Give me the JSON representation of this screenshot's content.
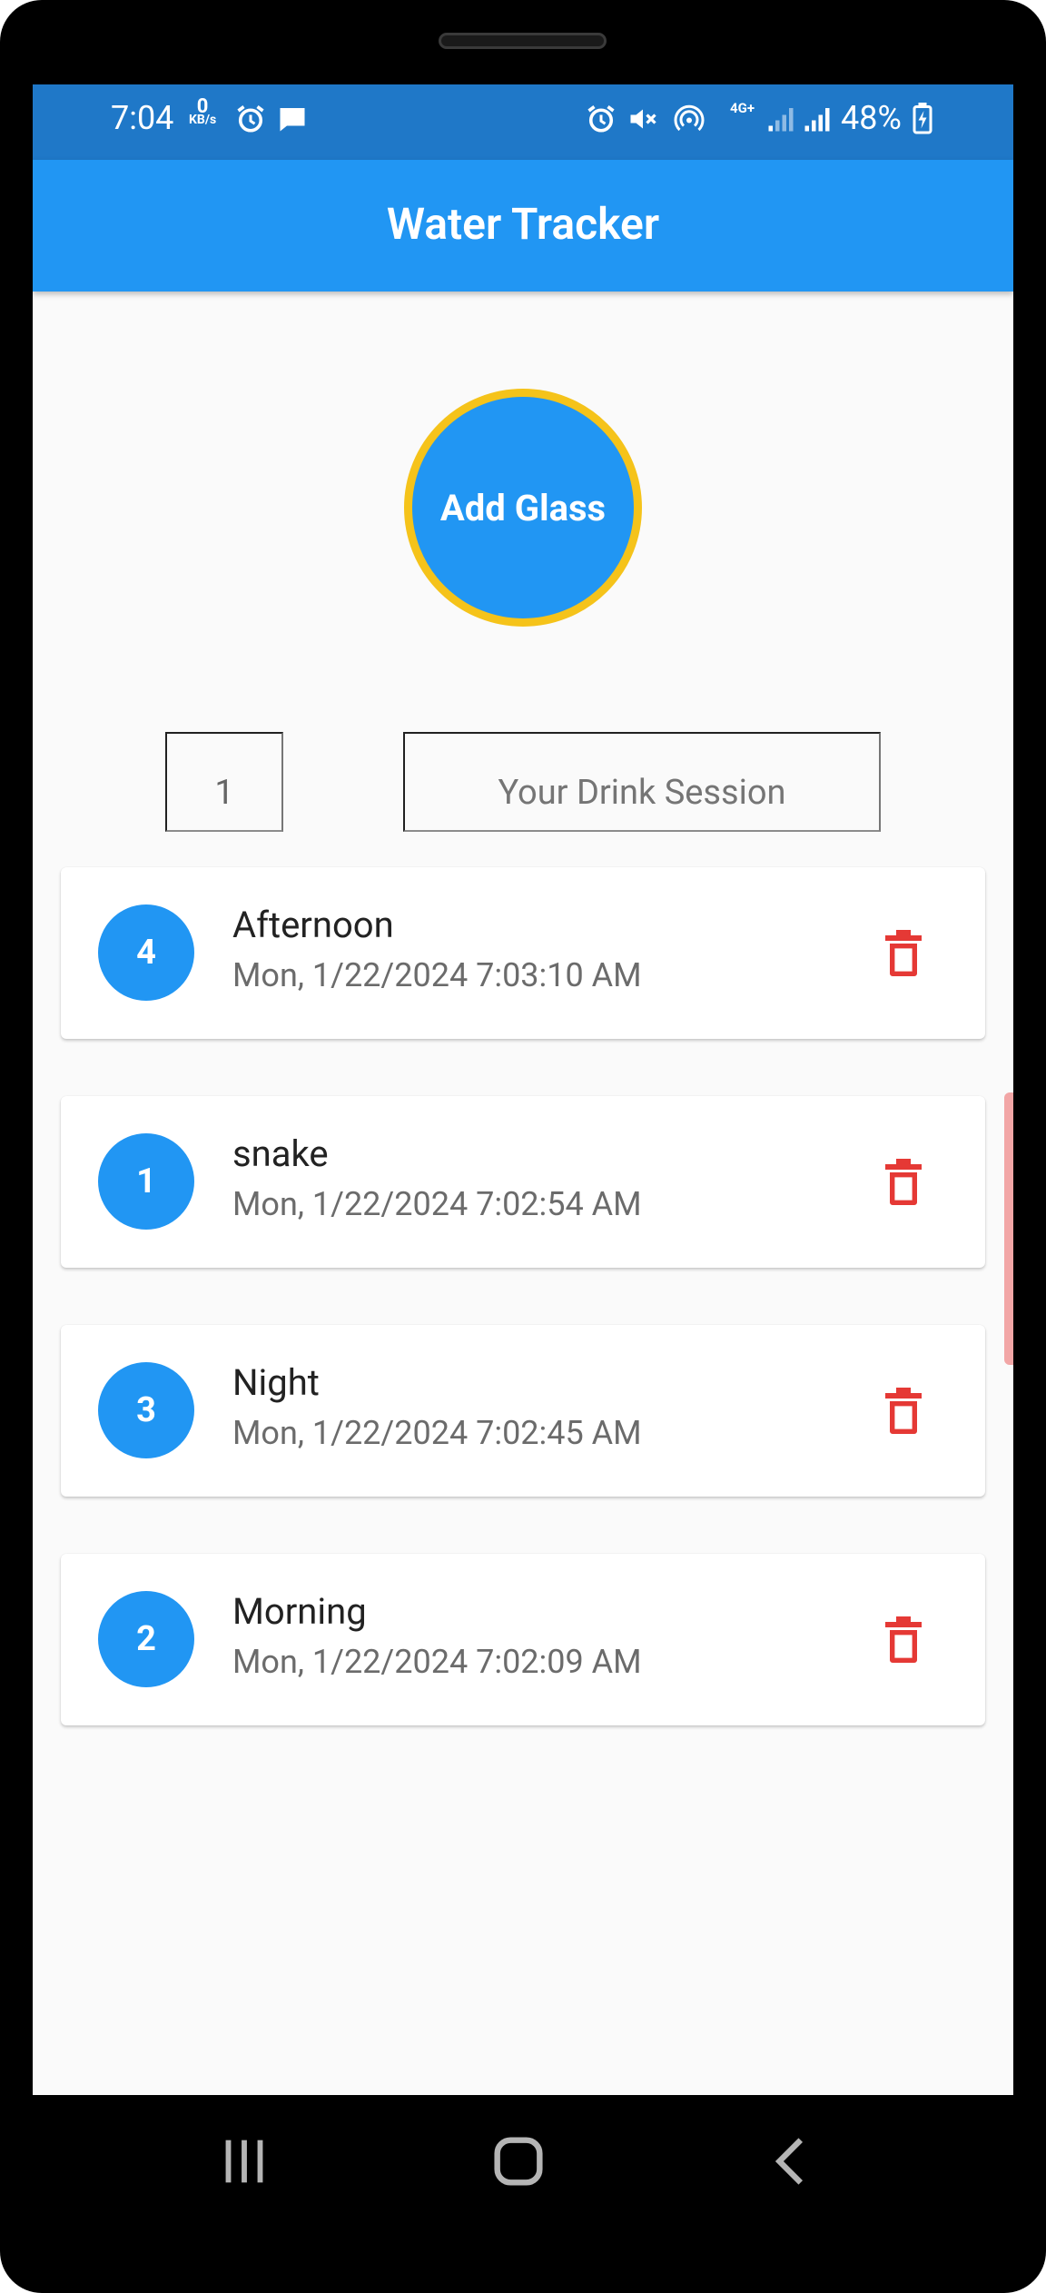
{
  "status_bar": {
    "time": "7:04",
    "net_speed_value": "0",
    "net_speed_unit": "KB/s",
    "network_type": "4G+",
    "battery": "48%"
  },
  "app_bar": {
    "title": "Water Tracker"
  },
  "add_button": {
    "label": "Add Glass"
  },
  "form": {
    "quantity_value": "1",
    "session_placeholder": "Your Drink Session"
  },
  "entries": [
    {
      "count": "4",
      "name": "Afternoon",
      "timestamp": "Mon, 1/22/2024 7:03:10 AM"
    },
    {
      "count": "1",
      "name": "snake",
      "timestamp": "Mon, 1/22/2024 7:02:54 AM"
    },
    {
      "count": "3",
      "name": "Night",
      "timestamp": "Mon, 1/22/2024 7:02:45 AM"
    },
    {
      "count": "2",
      "name": "Morning",
      "timestamp": "Mon, 1/22/2024 7:02:09 AM"
    }
  ],
  "icons": {
    "delete": "trash-icon",
    "nav_recents": "recents-icon",
    "nav_home": "home-icon",
    "nav_back": "back-icon"
  },
  "colors": {
    "primary": "#2196f3",
    "status_bar": "#1f78c8",
    "accent_border": "#f5c31a",
    "delete": "#e53935"
  }
}
